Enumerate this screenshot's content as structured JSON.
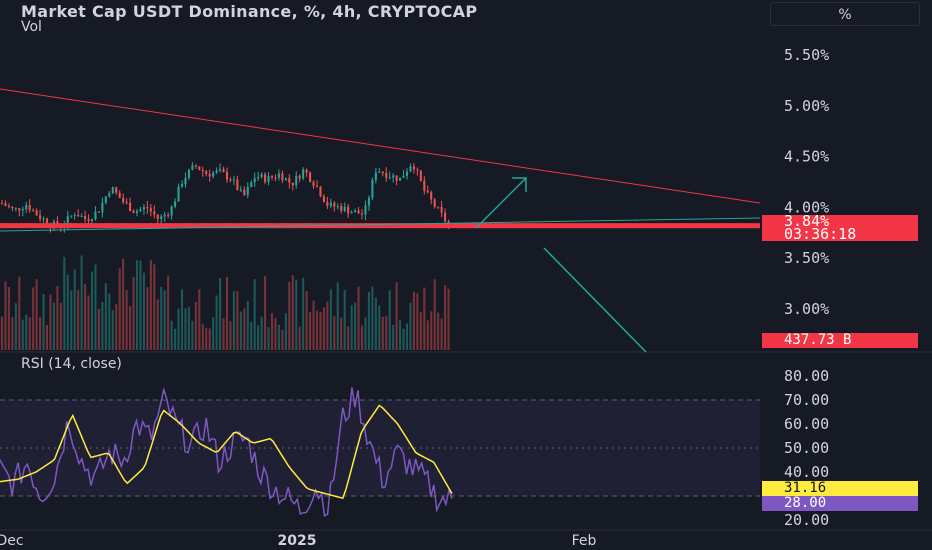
{
  "header": {
    "title": "Market Cap USDT Dominance, %, 4h, CRYPTOCAP",
    "vol_label": "Vol",
    "scale_button": "%"
  },
  "rsi": {
    "label": "RSI (14, close)",
    "value": "28.00",
    "ma_value": "31.16",
    "upper_band": 70,
    "lower_band": 30,
    "ticks": [
      "80.00",
      "70.00",
      "60.00",
      "50.00",
      "40.00",
      "30.00",
      "20.00"
    ]
  },
  "price_badge": {
    "value": "3.84%",
    "countdown": "03:36:18"
  },
  "volume_badge": {
    "value": "437.73 B"
  },
  "x_axis": {
    "labels": [
      "Dec",
      "2025",
      "Feb"
    ]
  },
  "colors": {
    "background": "#161a25",
    "up": "#26a69a",
    "down": "#ef5350",
    "trendline": "#f23645",
    "arrow": "#26a69a",
    "rsi_line": "#7e57c2",
    "rsi_ma": "#ffeb3b"
  },
  "chart_data": {
    "type": "candlestick",
    "title": "Market Cap USDT Dominance, %, 4h, CRYPTOCAP",
    "y_axis": {
      "ticks": [
        "5.50%",
        "5.00%",
        "4.50%",
        "4.00%",
        "3.50%",
        "3.00%"
      ],
      "range": [
        2.5,
        5.8
      ]
    },
    "close_path": [
      4.04,
      3.97,
      4.03,
      3.92,
      3.83,
      3.82,
      3.95,
      3.88,
      3.97,
      4.2,
      4.06,
      3.96,
      4.0,
      3.88,
      3.98,
      4.28,
      4.41,
      4.33,
      4.35,
      4.28,
      4.1,
      4.31,
      4.28,
      4.33,
      4.23,
      4.37,
      4.22,
      4.02,
      4.0,
      3.96,
      3.93,
      4.38,
      4.32,
      4.28,
      4.45,
      4.16,
      3.99,
      3.83
    ],
    "support_level": 3.82,
    "current_price": 3.84,
    "current_volume": "437.73 B",
    "rsi_path": [
      41,
      35,
      44,
      30,
      38,
      62,
      44,
      37,
      48,
      45,
      60,
      54,
      70,
      58,
      51,
      60,
      44,
      52,
      54,
      40,
      33,
      29,
      24,
      34,
      25,
      62,
      73,
      52,
      36,
      48,
      42,
      37,
      29,
      28
    ],
    "rsi_ma_path": [
      36,
      37,
      40,
      45,
      64,
      46,
      48,
      35,
      42,
      66,
      60,
      52,
      48,
      57,
      52,
      54,
      42,
      33,
      31,
      29,
      57,
      68,
      60,
      48,
      44,
      31
    ],
    "x_labels": [
      "Dec",
      "2025",
      "Feb"
    ]
  }
}
